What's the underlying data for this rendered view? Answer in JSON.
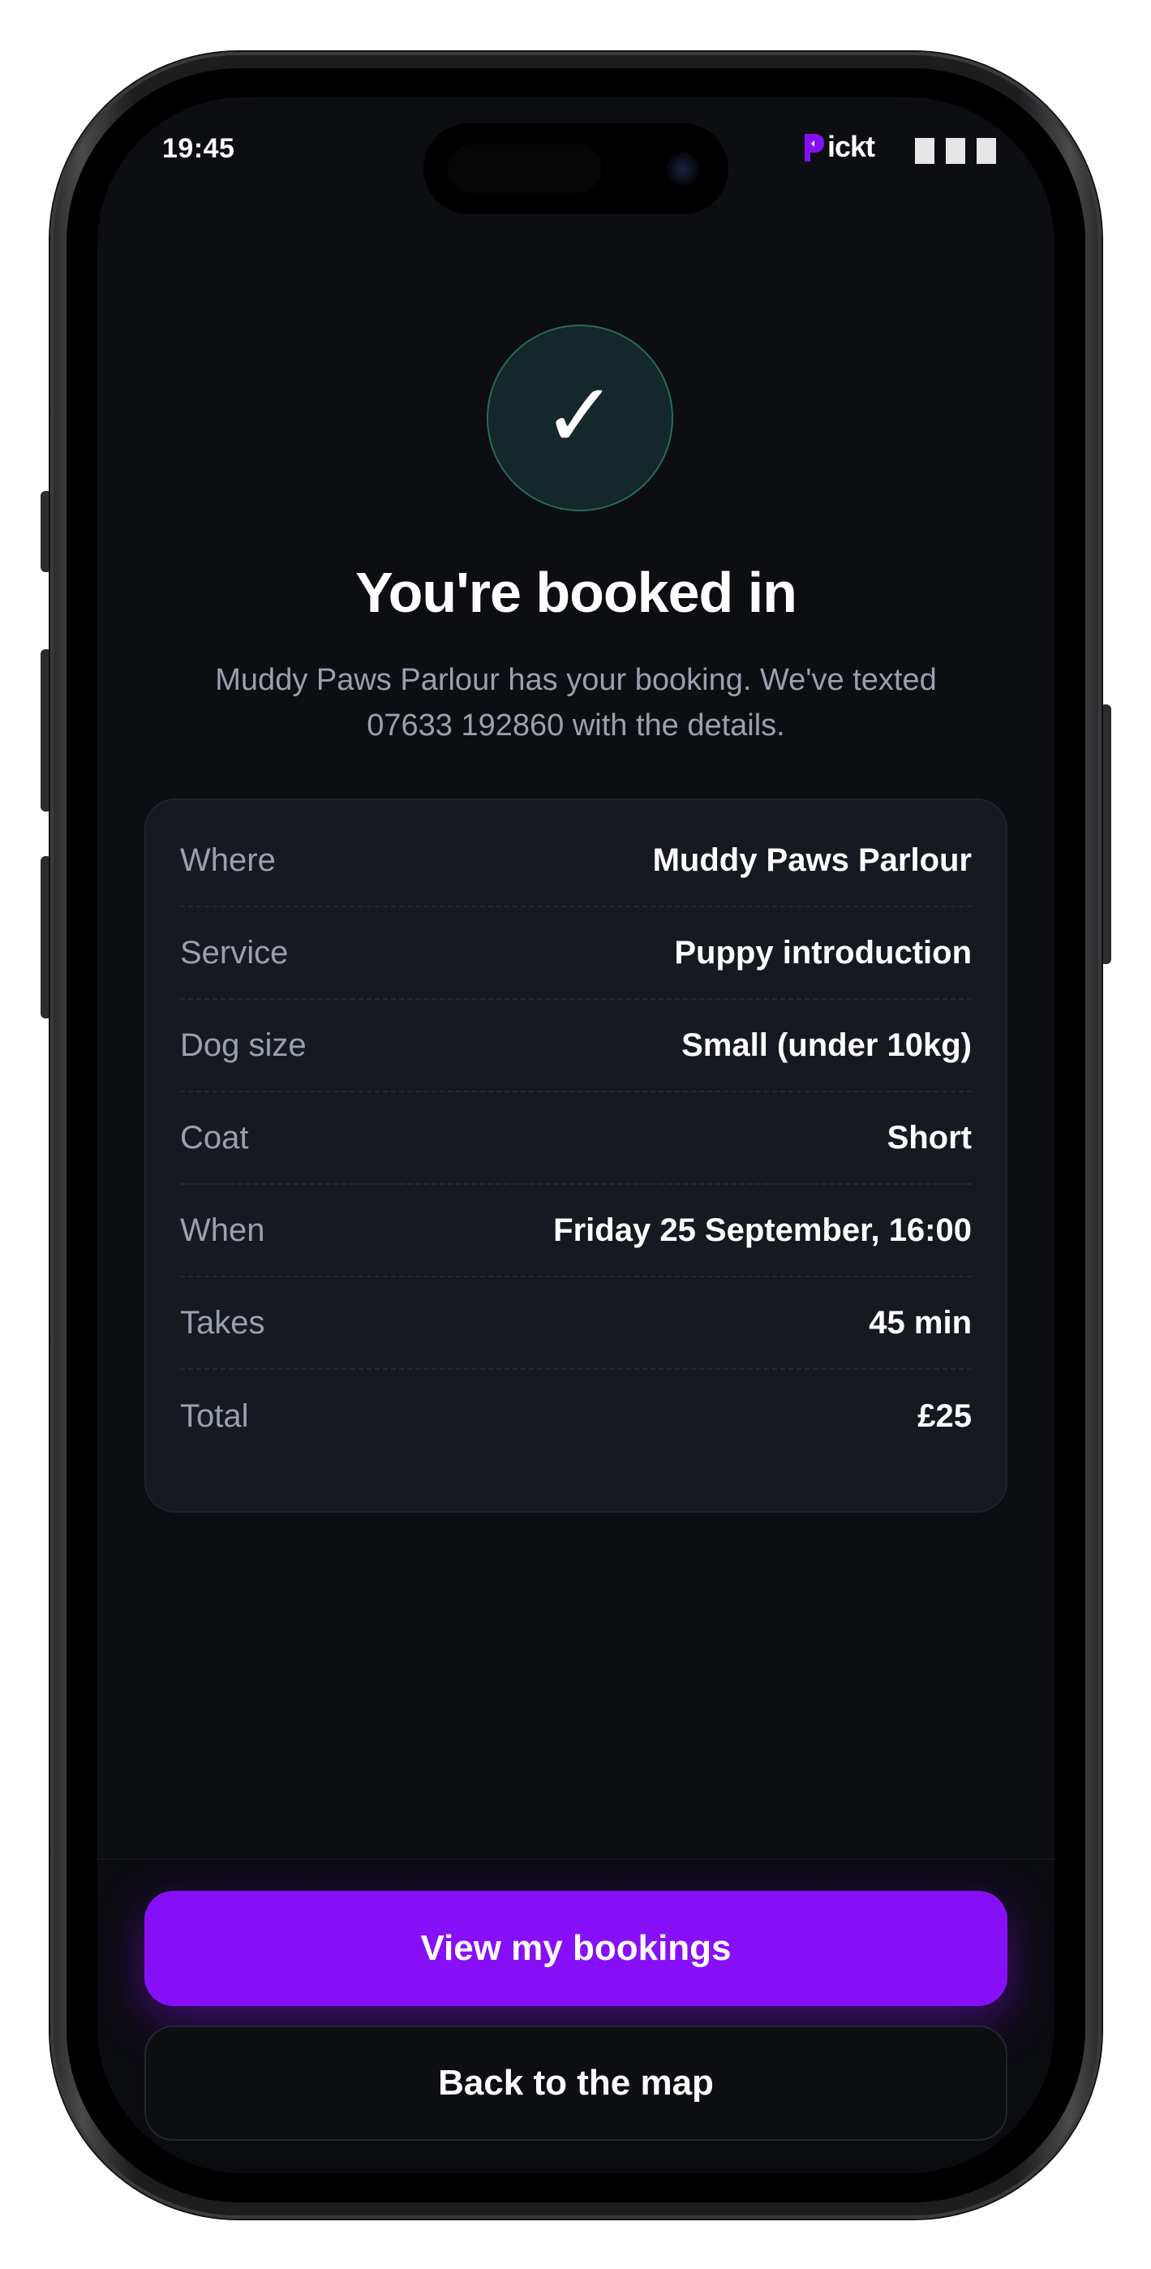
{
  "status_bar": {
    "time": "19:45",
    "brand": "ickt",
    "brand_accent": "#8810f8"
  },
  "success": {
    "icon": "check-icon",
    "glyph": "✓",
    "title": "You're booked in",
    "subtitle": "Muddy Paws Parlour has your booking. We've texted 07633 192860 with the details."
  },
  "details": [
    {
      "label": "Where",
      "value": "Muddy Paws Parlour"
    },
    {
      "label": "Service",
      "value": "Puppy introduction"
    },
    {
      "label": "Dog size",
      "value": "Small (under 10kg)"
    },
    {
      "label": "Coat",
      "value": "Short"
    },
    {
      "label": "When",
      "value": "Friday 25 September, 16:00"
    },
    {
      "label": "Takes",
      "value": "45 min"
    },
    {
      "label": "Total",
      "value": "£25"
    }
  ],
  "actions": {
    "primary_label": "View my bookings",
    "secondary_label": "Back to the map"
  },
  "colors": {
    "background": "#0d0e12",
    "card": "#161920",
    "primary": "#8810f8",
    "success_bg": "#14272a",
    "success_border": "#2a6a55"
  }
}
